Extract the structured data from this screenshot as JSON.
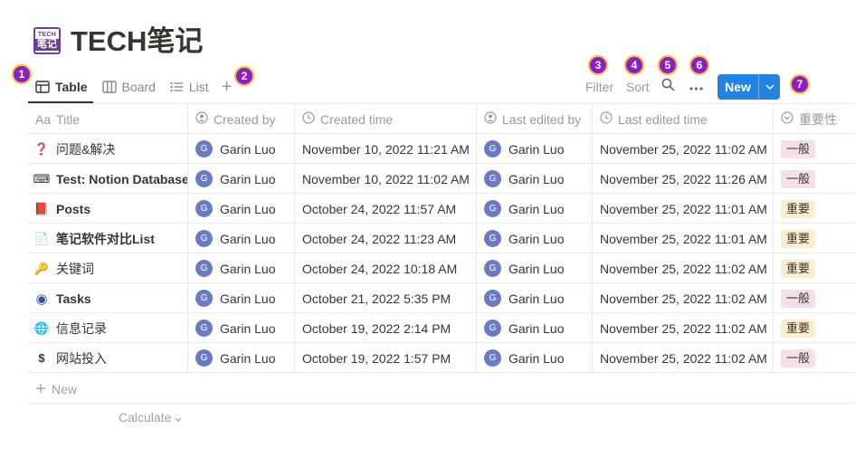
{
  "page": {
    "icon_text_top": "TECH",
    "icon_text_bottom": "笔记",
    "title": "TECH笔记"
  },
  "badges": [
    "1",
    "2",
    "3",
    "4",
    "5",
    "6",
    "7"
  ],
  "views": {
    "tabs": [
      {
        "label": "Table",
        "icon": "table-icon",
        "active": true
      },
      {
        "label": "Board",
        "icon": "board-icon",
        "active": false
      },
      {
        "label": "List",
        "icon": "list-icon",
        "active": false
      }
    ],
    "add_label": "+"
  },
  "toolbar": {
    "filter_label": "Filter",
    "sort_label": "Sort",
    "search_icon": "search-icon",
    "more_icon": "more-icon",
    "new_label": "New"
  },
  "table": {
    "columns": [
      {
        "label": "Title",
        "prefix": "Aa"
      },
      {
        "label": "Created by",
        "icon": "person-icon"
      },
      {
        "label": "Created time",
        "icon": "clock-icon"
      },
      {
        "label": "Last edited by",
        "icon": "person-icon"
      },
      {
        "label": "Last edited time",
        "icon": "clock-icon"
      },
      {
        "label": "重要性",
        "icon": "select-icon"
      }
    ],
    "rows": [
      {
        "icon": "❓",
        "title": "问题&解决",
        "bold": false,
        "created_by": "Garin Luo",
        "created_time": "November 10, 2022 11:21 AM",
        "edited_by": "Garin Luo",
        "edited_time": "November 25, 2022 11:02 AM",
        "importance": "一般"
      },
      {
        "icon": "⌨",
        "title": "Test: Notion Database",
        "bold": true,
        "created_by": "Garin Luo",
        "created_time": "November 10, 2022 11:02 AM",
        "edited_by": "Garin Luo",
        "edited_time": "November 25, 2022 11:26 AM",
        "importance": "一般"
      },
      {
        "icon": "📕",
        "title": "Posts",
        "bold": true,
        "created_by": "Garin Luo",
        "created_time": "October 24, 2022 11:57 AM",
        "edited_by": "Garin Luo",
        "edited_time": "November 25, 2022 11:01 AM",
        "importance": "重要"
      },
      {
        "icon": "📄",
        "title": "笔记软件对比List",
        "bold": true,
        "created_by": "Garin Luo",
        "created_time": "October 24, 2022 11:23 AM",
        "edited_by": "Garin Luo",
        "edited_time": "November 25, 2022 11:01 AM",
        "importance": "重要"
      },
      {
        "icon": "🔑",
        "title": "关键词",
        "bold": false,
        "created_by": "Garin Luo",
        "created_time": "October 24, 2022 10:18 AM",
        "edited_by": "Garin Luo",
        "edited_time": "November 25, 2022 11:02 AM",
        "importance": "重要"
      },
      {
        "icon": "◉",
        "title": "Tasks",
        "bold": true,
        "created_by": "Garin Luo",
        "created_time": "October 21, 2022 5:35 PM",
        "edited_by": "Garin Luo",
        "edited_time": "November 25, 2022 11:02 AM",
        "importance": "一般"
      },
      {
        "icon": "🌐",
        "title": "信息记录",
        "bold": false,
        "created_by": "Garin Luo",
        "created_time": "October 19, 2022 2:14 PM",
        "edited_by": "Garin Luo",
        "edited_time": "November 25, 2022 11:02 AM",
        "importance": "重要"
      },
      {
        "icon": "$",
        "title": "网站投入",
        "bold": false,
        "created_by": "Garin Luo",
        "created_time": "October 19, 2022 1:57 PM",
        "edited_by": "Garin Luo",
        "edited_time": "November 25, 2022 11:02 AM",
        "importance": "一般"
      }
    ],
    "avatar_letter": "G",
    "new_row_label": "New",
    "calculate_label": "Calculate"
  },
  "colors": {
    "accent": "#2383e2",
    "badge": "#8e1cc7",
    "badge_border": "#f2c23d",
    "tag_normal": "#f5e0e9",
    "tag_important": "#fbeecc",
    "avatar": "#6a7bc6"
  },
  "tag_colors": {
    "一般": "#f5e0e9",
    "重要": "#fbeecc"
  }
}
